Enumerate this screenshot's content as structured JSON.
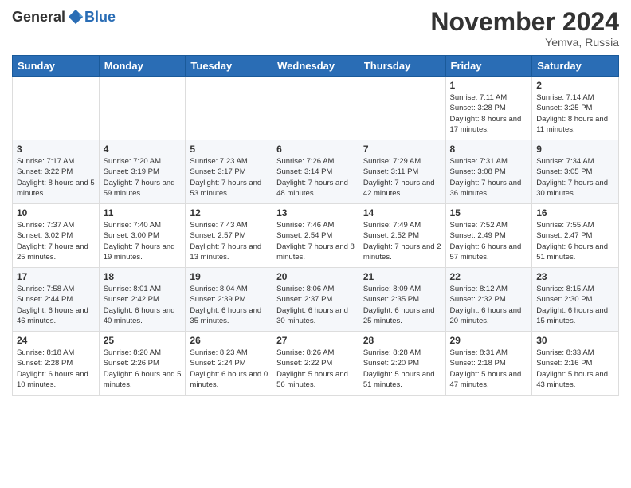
{
  "logo": {
    "general": "General",
    "blue": "Blue"
  },
  "header": {
    "month": "November 2024",
    "location": "Yemva, Russia"
  },
  "weekdays": [
    "Sunday",
    "Monday",
    "Tuesday",
    "Wednesday",
    "Thursday",
    "Friday",
    "Saturday"
  ],
  "weeks": [
    [
      {
        "day": "",
        "info": ""
      },
      {
        "day": "",
        "info": ""
      },
      {
        "day": "",
        "info": ""
      },
      {
        "day": "",
        "info": ""
      },
      {
        "day": "",
        "info": ""
      },
      {
        "day": "1",
        "info": "Sunrise: 7:11 AM\nSunset: 3:28 PM\nDaylight: 8 hours and 17 minutes."
      },
      {
        "day": "2",
        "info": "Sunrise: 7:14 AM\nSunset: 3:25 PM\nDaylight: 8 hours and 11 minutes."
      }
    ],
    [
      {
        "day": "3",
        "info": "Sunrise: 7:17 AM\nSunset: 3:22 PM\nDaylight: 8 hours and 5 minutes."
      },
      {
        "day": "4",
        "info": "Sunrise: 7:20 AM\nSunset: 3:19 PM\nDaylight: 7 hours and 59 minutes."
      },
      {
        "day": "5",
        "info": "Sunrise: 7:23 AM\nSunset: 3:17 PM\nDaylight: 7 hours and 53 minutes."
      },
      {
        "day": "6",
        "info": "Sunrise: 7:26 AM\nSunset: 3:14 PM\nDaylight: 7 hours and 48 minutes."
      },
      {
        "day": "7",
        "info": "Sunrise: 7:29 AM\nSunset: 3:11 PM\nDaylight: 7 hours and 42 minutes."
      },
      {
        "day": "8",
        "info": "Sunrise: 7:31 AM\nSunset: 3:08 PM\nDaylight: 7 hours and 36 minutes."
      },
      {
        "day": "9",
        "info": "Sunrise: 7:34 AM\nSunset: 3:05 PM\nDaylight: 7 hours and 30 minutes."
      }
    ],
    [
      {
        "day": "10",
        "info": "Sunrise: 7:37 AM\nSunset: 3:02 PM\nDaylight: 7 hours and 25 minutes."
      },
      {
        "day": "11",
        "info": "Sunrise: 7:40 AM\nSunset: 3:00 PM\nDaylight: 7 hours and 19 minutes."
      },
      {
        "day": "12",
        "info": "Sunrise: 7:43 AM\nSunset: 2:57 PM\nDaylight: 7 hours and 13 minutes."
      },
      {
        "day": "13",
        "info": "Sunrise: 7:46 AM\nSunset: 2:54 PM\nDaylight: 7 hours and 8 minutes."
      },
      {
        "day": "14",
        "info": "Sunrise: 7:49 AM\nSunset: 2:52 PM\nDaylight: 7 hours and 2 minutes."
      },
      {
        "day": "15",
        "info": "Sunrise: 7:52 AM\nSunset: 2:49 PM\nDaylight: 6 hours and 57 minutes."
      },
      {
        "day": "16",
        "info": "Sunrise: 7:55 AM\nSunset: 2:47 PM\nDaylight: 6 hours and 51 minutes."
      }
    ],
    [
      {
        "day": "17",
        "info": "Sunrise: 7:58 AM\nSunset: 2:44 PM\nDaylight: 6 hours and 46 minutes."
      },
      {
        "day": "18",
        "info": "Sunrise: 8:01 AM\nSunset: 2:42 PM\nDaylight: 6 hours and 40 minutes."
      },
      {
        "day": "19",
        "info": "Sunrise: 8:04 AM\nSunset: 2:39 PM\nDaylight: 6 hours and 35 minutes."
      },
      {
        "day": "20",
        "info": "Sunrise: 8:06 AM\nSunset: 2:37 PM\nDaylight: 6 hours and 30 minutes."
      },
      {
        "day": "21",
        "info": "Sunrise: 8:09 AM\nSunset: 2:35 PM\nDaylight: 6 hours and 25 minutes."
      },
      {
        "day": "22",
        "info": "Sunrise: 8:12 AM\nSunset: 2:32 PM\nDaylight: 6 hours and 20 minutes."
      },
      {
        "day": "23",
        "info": "Sunrise: 8:15 AM\nSunset: 2:30 PM\nDaylight: 6 hours and 15 minutes."
      }
    ],
    [
      {
        "day": "24",
        "info": "Sunrise: 8:18 AM\nSunset: 2:28 PM\nDaylight: 6 hours and 10 minutes."
      },
      {
        "day": "25",
        "info": "Sunrise: 8:20 AM\nSunset: 2:26 PM\nDaylight: 6 hours and 5 minutes."
      },
      {
        "day": "26",
        "info": "Sunrise: 8:23 AM\nSunset: 2:24 PM\nDaylight: 6 hours and 0 minutes."
      },
      {
        "day": "27",
        "info": "Sunrise: 8:26 AM\nSunset: 2:22 PM\nDaylight: 5 hours and 56 minutes."
      },
      {
        "day": "28",
        "info": "Sunrise: 8:28 AM\nSunset: 2:20 PM\nDaylight: 5 hours and 51 minutes."
      },
      {
        "day": "29",
        "info": "Sunrise: 8:31 AM\nSunset: 2:18 PM\nDaylight: 5 hours and 47 minutes."
      },
      {
        "day": "30",
        "info": "Sunrise: 8:33 AM\nSunset: 2:16 PM\nDaylight: 5 hours and 43 minutes."
      }
    ]
  ]
}
